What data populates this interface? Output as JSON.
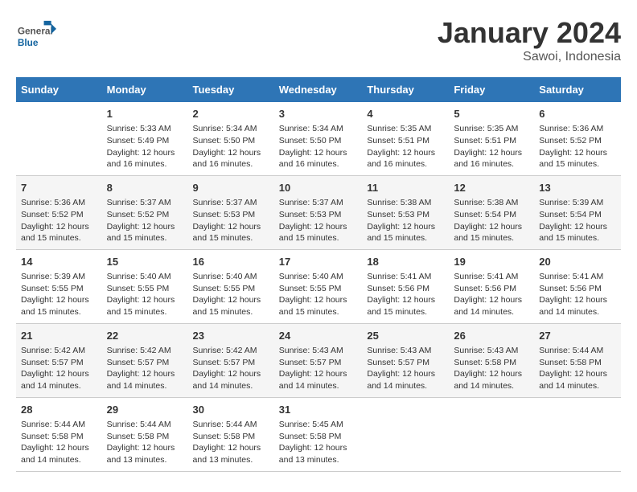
{
  "header": {
    "logo_general": "General",
    "logo_blue": "Blue",
    "month_year": "January 2024",
    "location": "Sawoi, Indonesia"
  },
  "days_of_week": [
    "Sunday",
    "Monday",
    "Tuesday",
    "Wednesday",
    "Thursday",
    "Friday",
    "Saturday"
  ],
  "weeks": [
    [
      {
        "day": "",
        "info": ""
      },
      {
        "day": "1",
        "info": "Sunrise: 5:33 AM\nSunset: 5:49 PM\nDaylight: 12 hours\nand 16 minutes."
      },
      {
        "day": "2",
        "info": "Sunrise: 5:34 AM\nSunset: 5:50 PM\nDaylight: 12 hours\nand 16 minutes."
      },
      {
        "day": "3",
        "info": "Sunrise: 5:34 AM\nSunset: 5:50 PM\nDaylight: 12 hours\nand 16 minutes."
      },
      {
        "day": "4",
        "info": "Sunrise: 5:35 AM\nSunset: 5:51 PM\nDaylight: 12 hours\nand 16 minutes."
      },
      {
        "day": "5",
        "info": "Sunrise: 5:35 AM\nSunset: 5:51 PM\nDaylight: 12 hours\nand 16 minutes."
      },
      {
        "day": "6",
        "info": "Sunrise: 5:36 AM\nSunset: 5:52 PM\nDaylight: 12 hours\nand 15 minutes."
      }
    ],
    [
      {
        "day": "7",
        "info": "Sunrise: 5:36 AM\nSunset: 5:52 PM\nDaylight: 12 hours\nand 15 minutes."
      },
      {
        "day": "8",
        "info": "Sunrise: 5:37 AM\nSunset: 5:52 PM\nDaylight: 12 hours\nand 15 minutes."
      },
      {
        "day": "9",
        "info": "Sunrise: 5:37 AM\nSunset: 5:53 PM\nDaylight: 12 hours\nand 15 minutes."
      },
      {
        "day": "10",
        "info": "Sunrise: 5:37 AM\nSunset: 5:53 PM\nDaylight: 12 hours\nand 15 minutes."
      },
      {
        "day": "11",
        "info": "Sunrise: 5:38 AM\nSunset: 5:53 PM\nDaylight: 12 hours\nand 15 minutes."
      },
      {
        "day": "12",
        "info": "Sunrise: 5:38 AM\nSunset: 5:54 PM\nDaylight: 12 hours\nand 15 minutes."
      },
      {
        "day": "13",
        "info": "Sunrise: 5:39 AM\nSunset: 5:54 PM\nDaylight: 12 hours\nand 15 minutes."
      }
    ],
    [
      {
        "day": "14",
        "info": "Sunrise: 5:39 AM\nSunset: 5:55 PM\nDaylight: 12 hours\nand 15 minutes."
      },
      {
        "day": "15",
        "info": "Sunrise: 5:40 AM\nSunset: 5:55 PM\nDaylight: 12 hours\nand 15 minutes."
      },
      {
        "day": "16",
        "info": "Sunrise: 5:40 AM\nSunset: 5:55 PM\nDaylight: 12 hours\nand 15 minutes."
      },
      {
        "day": "17",
        "info": "Sunrise: 5:40 AM\nSunset: 5:55 PM\nDaylight: 12 hours\nand 15 minutes."
      },
      {
        "day": "18",
        "info": "Sunrise: 5:41 AM\nSunset: 5:56 PM\nDaylight: 12 hours\nand 15 minutes."
      },
      {
        "day": "19",
        "info": "Sunrise: 5:41 AM\nSunset: 5:56 PM\nDaylight: 12 hours\nand 14 minutes."
      },
      {
        "day": "20",
        "info": "Sunrise: 5:41 AM\nSunset: 5:56 PM\nDaylight: 12 hours\nand 14 minutes."
      }
    ],
    [
      {
        "day": "21",
        "info": "Sunrise: 5:42 AM\nSunset: 5:57 PM\nDaylight: 12 hours\nand 14 minutes."
      },
      {
        "day": "22",
        "info": "Sunrise: 5:42 AM\nSunset: 5:57 PM\nDaylight: 12 hours\nand 14 minutes."
      },
      {
        "day": "23",
        "info": "Sunrise: 5:42 AM\nSunset: 5:57 PM\nDaylight: 12 hours\nand 14 minutes."
      },
      {
        "day": "24",
        "info": "Sunrise: 5:43 AM\nSunset: 5:57 PM\nDaylight: 12 hours\nand 14 minutes."
      },
      {
        "day": "25",
        "info": "Sunrise: 5:43 AM\nSunset: 5:57 PM\nDaylight: 12 hours\nand 14 minutes."
      },
      {
        "day": "26",
        "info": "Sunrise: 5:43 AM\nSunset: 5:58 PM\nDaylight: 12 hours\nand 14 minutes."
      },
      {
        "day": "27",
        "info": "Sunrise: 5:44 AM\nSunset: 5:58 PM\nDaylight: 12 hours\nand 14 minutes."
      }
    ],
    [
      {
        "day": "28",
        "info": "Sunrise: 5:44 AM\nSunset: 5:58 PM\nDaylight: 12 hours\nand 14 minutes."
      },
      {
        "day": "29",
        "info": "Sunrise: 5:44 AM\nSunset: 5:58 PM\nDaylight: 12 hours\nand 13 minutes."
      },
      {
        "day": "30",
        "info": "Sunrise: 5:44 AM\nSunset: 5:58 PM\nDaylight: 12 hours\nand 13 minutes."
      },
      {
        "day": "31",
        "info": "Sunrise: 5:45 AM\nSunset: 5:58 PM\nDaylight: 12 hours\nand 13 minutes."
      },
      {
        "day": "",
        "info": ""
      },
      {
        "day": "",
        "info": ""
      },
      {
        "day": "",
        "info": ""
      }
    ]
  ]
}
